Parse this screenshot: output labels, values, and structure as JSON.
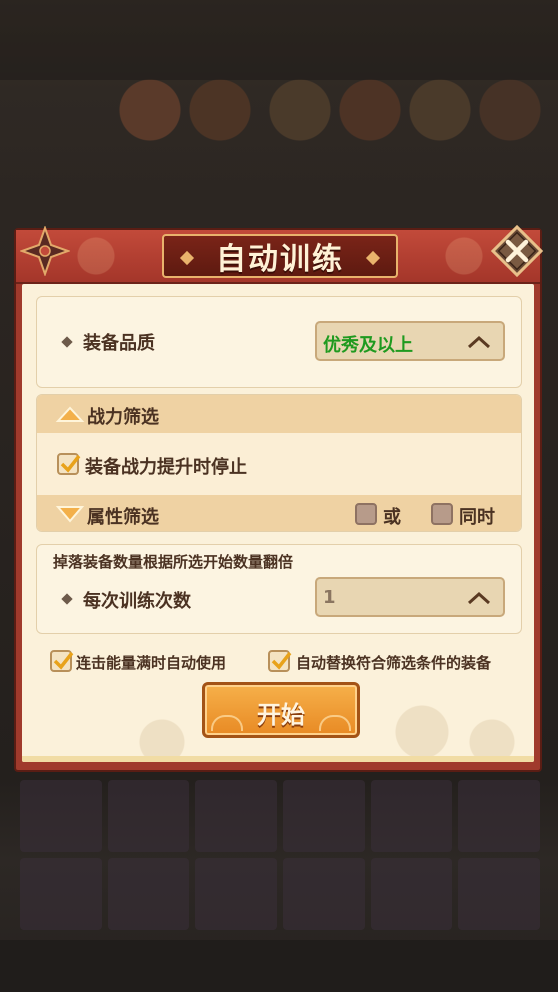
{
  "dialog": {
    "title": "自动训练",
    "quality": {
      "label": "装备品质",
      "value": "优秀及以上"
    },
    "power_filter": {
      "header": "战力筛选",
      "checkbox_label": "装备战力提升时停止",
      "checked": true
    },
    "attribute_filter": {
      "header": "属性筛选",
      "option_or": "或",
      "option_both": "同时"
    },
    "training": {
      "note": "掉落装备数量根据所选开始数量翻倍",
      "label": "每次训练次数",
      "value": "1"
    },
    "options": {
      "auto_use": "连击能量满时自动使用",
      "auto_replace": "自动替换符合筛选条件的装备"
    },
    "start_button": "开始"
  },
  "colors": {
    "frame": "#a03a2c",
    "panel": "#fbf1da",
    "quality_text": "#1f9a1f",
    "button": "#f0a038"
  }
}
